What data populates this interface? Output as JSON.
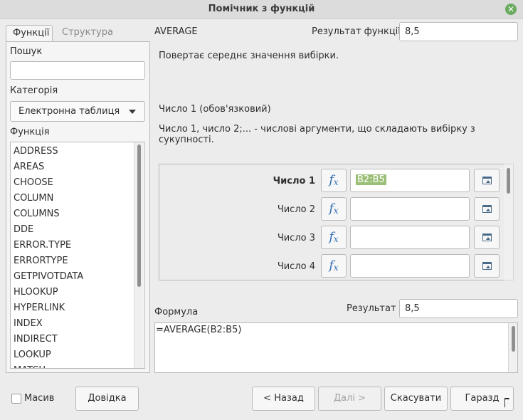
{
  "window": {
    "title": "Помічник з функцій"
  },
  "tabs": [
    {
      "label": "Функції",
      "active": true
    },
    {
      "label": "Структура",
      "active": false
    }
  ],
  "search": {
    "label": "Пошук",
    "value": ""
  },
  "category": {
    "label": "Категорія",
    "selected": "Електронна таблиця"
  },
  "functions": {
    "label": "Функція",
    "items": [
      "ADDRESS",
      "AREAS",
      "CHOOSE",
      "COLUMN",
      "COLUMNS",
      "DDE",
      "ERROR.TYPE",
      "ERRORTYPE",
      "GETPIVOTDATA",
      "HLOOKUP",
      "HYPERLINK",
      "INDEX",
      "INDIRECT",
      "LOOKUP",
      "MATCH"
    ]
  },
  "function_info": {
    "name": "AVERAGE",
    "result_label": "Результат функції",
    "result_value": "8,5",
    "description": "Повертає середнє значення вибірки.",
    "arg_title": "Число 1 (обов'язковий)",
    "arg_description": "Число 1, число 2;... - числові аргументи, що складають вибірку з сукупності."
  },
  "args": [
    {
      "label": "Число 1",
      "value": "B2:B5",
      "bold": true
    },
    {
      "label": "Число 2",
      "value": ""
    },
    {
      "label": "Число 3",
      "value": ""
    },
    {
      "label": "Число 4",
      "value": ""
    }
  ],
  "fx_symbol": "f",
  "fx_sub": "x",
  "formula": {
    "label": "Формула",
    "value": "=AVERAGE(B2:B5)",
    "result_label": "Результат",
    "result_value": "8,5"
  },
  "array_checkbox": {
    "label": "Масив",
    "checked": false
  },
  "buttons": {
    "help": "Довідка",
    "back": "< Назад",
    "next": "Далі >",
    "cancel": "Скасувати",
    "ok": "Гаразд"
  },
  "icons": {
    "close": "close-icon",
    "shrink": "shrink-icon",
    "fx": "function-icon"
  },
  "colors": {
    "selection": "#9bbf76",
    "close": "#6aab5f",
    "fx": "#2f6db5"
  }
}
